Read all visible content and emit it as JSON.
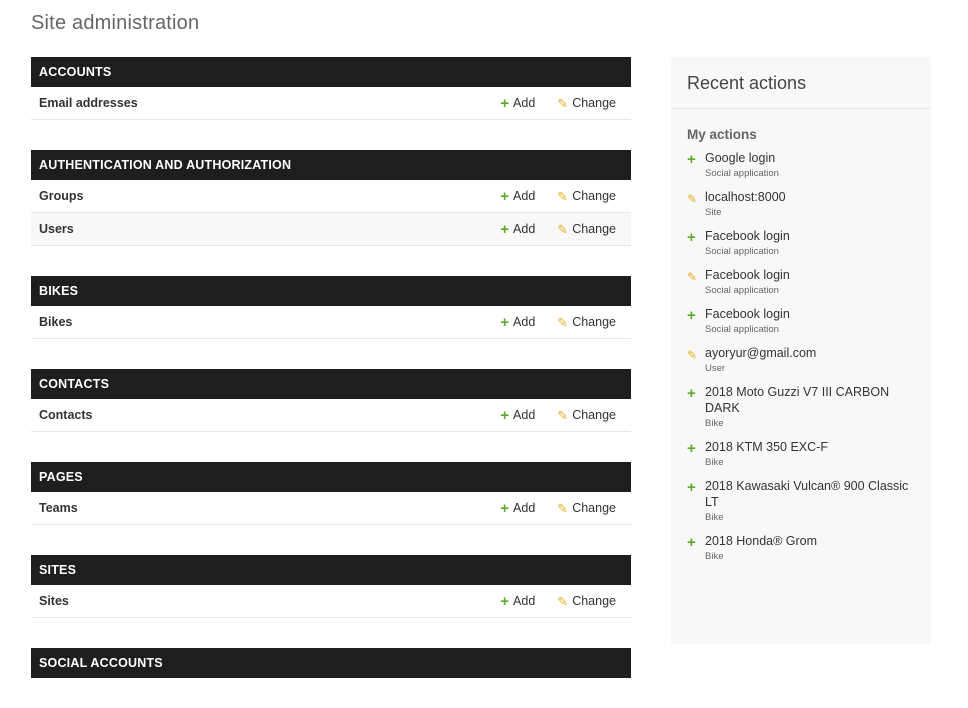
{
  "page_title": "Site administration",
  "modules": [
    {
      "name": "ACCOUNTS",
      "models": [
        {
          "name": "Email addresses"
        }
      ]
    },
    {
      "name": "AUTHENTICATION AND AUTHORIZATION",
      "models": [
        {
          "name": "Groups"
        },
        {
          "name": "Users"
        }
      ]
    },
    {
      "name": "BIKES",
      "models": [
        {
          "name": "Bikes"
        }
      ]
    },
    {
      "name": "CONTACTS",
      "models": [
        {
          "name": "Contacts"
        }
      ]
    },
    {
      "name": "PAGES",
      "models": [
        {
          "name": "Teams"
        }
      ]
    },
    {
      "name": "SITES",
      "models": [
        {
          "name": "Sites"
        }
      ]
    },
    {
      "name": "SOCIAL ACCOUNTS",
      "models": []
    }
  ],
  "labels": {
    "add": "Add",
    "change": "Change"
  },
  "recent": {
    "title": "Recent actions",
    "subtitle": "My actions",
    "items": [
      {
        "icon": "plus",
        "text": "Google login",
        "type": "Social application"
      },
      {
        "icon": "pencil",
        "text": "localhost:8000",
        "type": "Site"
      },
      {
        "icon": "plus",
        "text": "Facebook login",
        "type": "Social application"
      },
      {
        "icon": "pencil",
        "text": "Facebook login",
        "type": "Social application"
      },
      {
        "icon": "plus",
        "text": "Facebook login",
        "type": "Social application"
      },
      {
        "icon": "pencil",
        "text": "ayoryur@gmail.com",
        "type": "User"
      },
      {
        "icon": "plus",
        "text": "2018 Moto Guzzi V7 III CARBON DARK",
        "type": "Bike"
      },
      {
        "icon": "plus",
        "text": "2018 KTM 350 EXC-F",
        "type": "Bike"
      },
      {
        "icon": "plus",
        "text": "2018 Kawasaki Vulcan® 900 Classic LT",
        "type": "Bike"
      },
      {
        "icon": "plus",
        "text": "2018 Honda® Grom",
        "type": "Bike"
      }
    ]
  },
  "colors": {
    "header_bg": "#1e1e1e",
    "add_green": "#5daa2a",
    "change_yellow": "#e8b024"
  }
}
